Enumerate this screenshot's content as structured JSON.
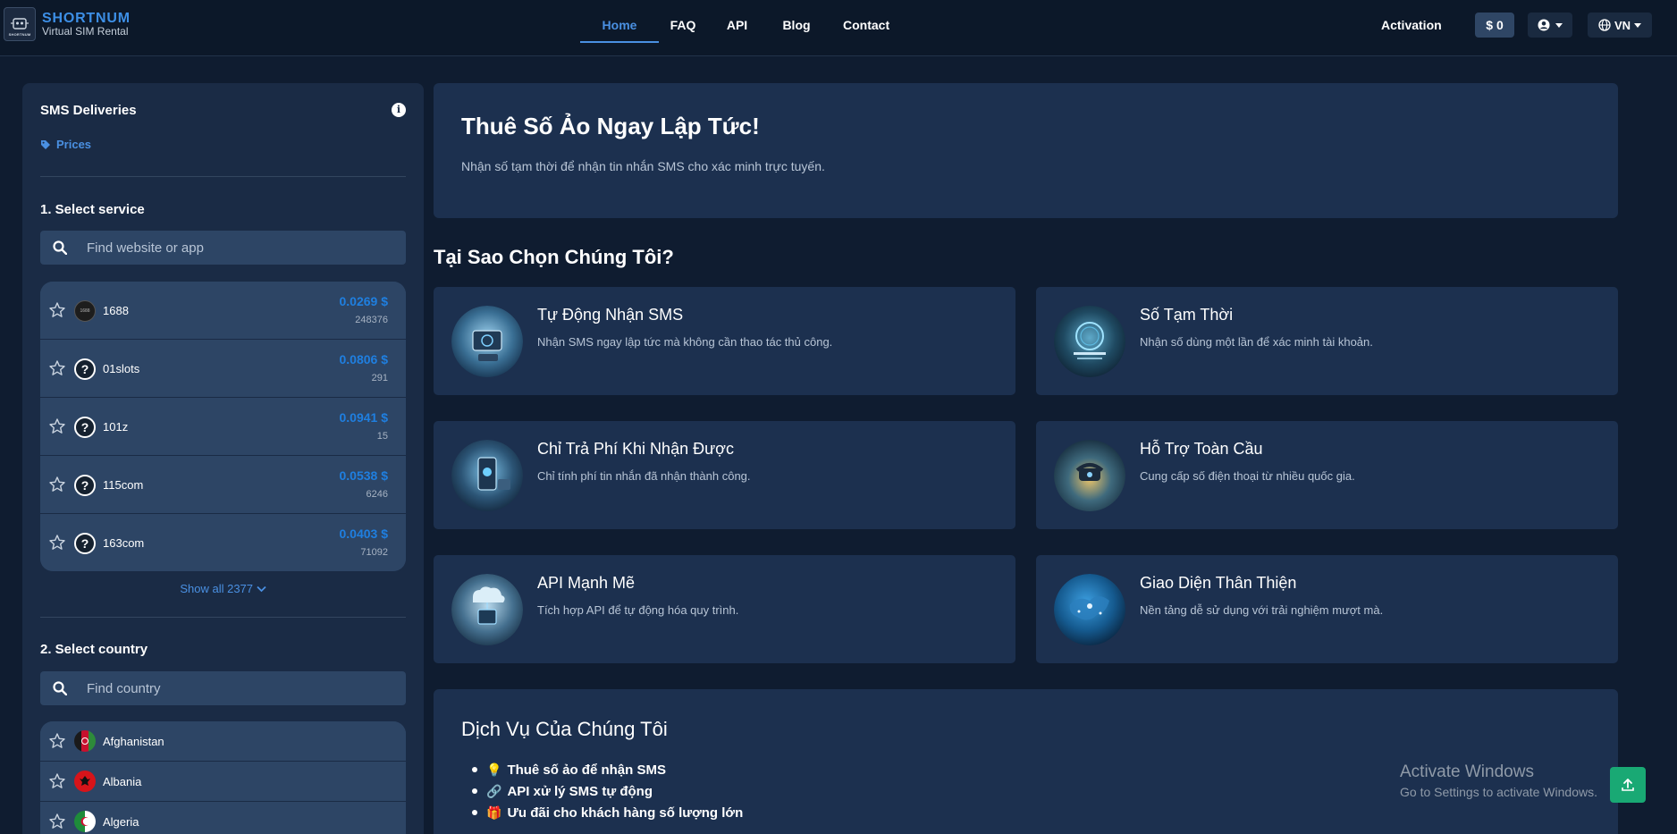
{
  "brand": {
    "name": "SHORTNUM",
    "subtitle": "Virtual SIM Rental",
    "logo_text": "SHORTNUM"
  },
  "nav": {
    "links": [
      {
        "label": "Home",
        "active": true
      },
      {
        "label": "FAQ"
      },
      {
        "label": "API"
      },
      {
        "label": "Blog"
      },
      {
        "label": "Contact"
      }
    ],
    "activation_label": "Activation",
    "balance": "$ 0",
    "language": "VN"
  },
  "sidebar": {
    "title": "SMS Deliveries",
    "prices_link": "Prices",
    "select_service_title": "1. Select service",
    "service_search_placeholder": "Find website or app",
    "services": [
      {
        "name": "1688",
        "price": "0.0269 $",
        "count": "248376"
      },
      {
        "name": "01slots",
        "price": "0.0806 $",
        "count": "291"
      },
      {
        "name": "101z",
        "price": "0.0941 $",
        "count": "15"
      },
      {
        "name": "115com",
        "price": "0.0538 $",
        "count": "6246"
      },
      {
        "name": "163com",
        "price": "0.0403 $",
        "count": "71092"
      }
    ],
    "show_all": "Show all 2377",
    "select_country_title": "2. Select country",
    "country_search_placeholder": "Find country",
    "countries": [
      {
        "name": "Afghanistan"
      },
      {
        "name": "Albania"
      },
      {
        "name": "Algeria"
      }
    ]
  },
  "hero": {
    "title": "Thuê Số Ảo Ngay Lập Tức!",
    "subtitle": "Nhận số tạm thời để nhận tin nhắn SMS cho xác minh trực tuyến."
  },
  "why": {
    "title": "Tại Sao Chọn Chúng Tôi?",
    "features": [
      {
        "title": "Tự Động Nhận SMS",
        "desc": "Nhận SMS ngay lập tức mà không cần thao tác thủ công."
      },
      {
        "title": "Số Tạm Thời",
        "desc": "Nhận số dùng một lần để xác minh tài khoản."
      },
      {
        "title": "Chỉ Trả Phí Khi Nhận Được",
        "desc": "Chỉ tính phí tin nhắn đã nhận thành công."
      },
      {
        "title": "Hỗ Trợ Toàn Cầu",
        "desc": "Cung cấp số điện thoại từ nhiều quốc gia."
      },
      {
        "title": "API Mạnh Mẽ",
        "desc": "Tích hợp API để tự động hóa quy trình."
      },
      {
        "title": "Giao Diện Thân Thiện",
        "desc": "Nền tảng dễ sử dụng với trải nghiệm mượt mà."
      }
    ]
  },
  "services": {
    "title": "Dịch Vụ Của Chúng Tôi",
    "items": [
      {
        "emoji": "💡",
        "text": "Thuê số ảo để nhận SMS"
      },
      {
        "emoji": "🔗",
        "text": "API xử lý SMS tự động"
      },
      {
        "emoji": "🎁",
        "text": "Ưu đãi cho khách hàng số lượng lớn"
      }
    ]
  },
  "windows_watermark": {
    "line1": "Activate Windows",
    "line2": "Go to Settings to activate Windows."
  },
  "colors": {
    "background": "#0f1c30",
    "panel": "#1c304f",
    "accent": "#4a90e2",
    "price": "#1f7fe0",
    "scroll_top": "#19a974"
  }
}
